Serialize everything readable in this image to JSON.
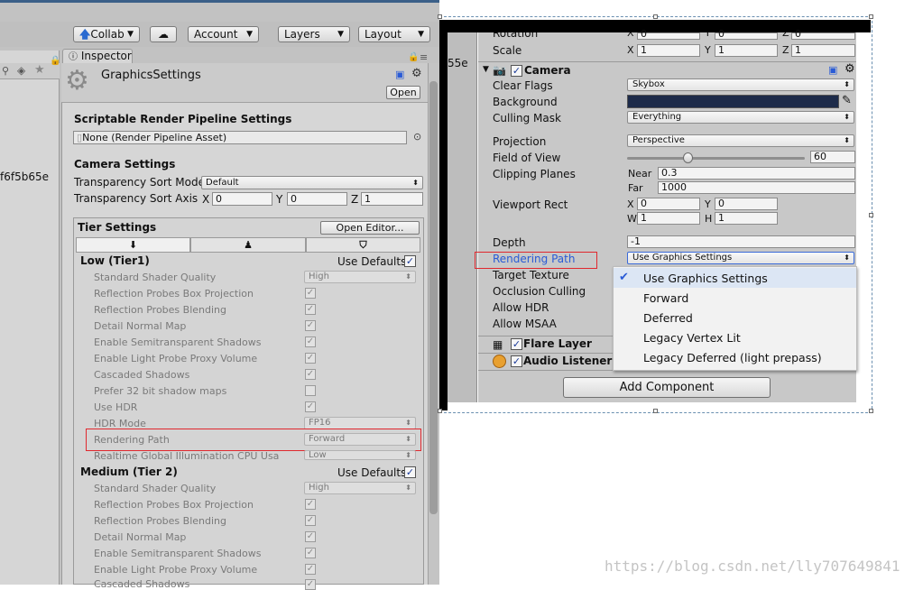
{
  "toolbar": {
    "collab": "Collab",
    "account": "Account",
    "layers": "Layers",
    "layout": "Layout"
  },
  "hierarchy": {
    "hash_fragment": "f6f5b65e",
    "hash_fragment_right": "55e"
  },
  "inspector": {
    "tab": "Inspector",
    "asset_title": "GraphicsSettings",
    "open_button": "Open",
    "srp_header": "Scriptable Render Pipeline Settings",
    "srp_field": "None (Render Pipeline Asset)",
    "camera_header": "Camera Settings",
    "sort_mode_label": "Transparency Sort Mode",
    "sort_mode_value": "Default",
    "sort_axis_label": "Transparency Sort Axis",
    "sort_axis": {
      "x_label": "X",
      "x": "0",
      "y_label": "Y",
      "y": "0",
      "z_label": "Z",
      "z": "1"
    },
    "tier_header": "Tier Settings",
    "open_editor": "Open Editor...",
    "tier1": {
      "title": "Low (Tier1)",
      "use_defaults": "Use Defaults",
      "rows": [
        {
          "label": "Standard Shader Quality",
          "value": "High"
        },
        {
          "label": "Reflection Probes Box Projection",
          "checked": true
        },
        {
          "label": "Reflection Probes Blending",
          "checked": true
        },
        {
          "label": "Detail Normal Map",
          "checked": true
        },
        {
          "label": "Enable Semitransparent Shadows",
          "checked": true
        },
        {
          "label": "Enable Light Probe Proxy Volume",
          "checked": true
        },
        {
          "label": "Cascaded Shadows",
          "checked": true
        },
        {
          "label": "Prefer 32 bit shadow maps",
          "checked": false
        },
        {
          "label": "Use HDR",
          "checked": true
        },
        {
          "label": "HDR Mode",
          "value": "FP16"
        },
        {
          "label": "Rendering Path",
          "value": "Forward"
        },
        {
          "label": "Realtime Global Illumination CPU Usa",
          "value": "Low"
        }
      ]
    },
    "tier2": {
      "title": "Medium (Tier 2)",
      "use_defaults": "Use Defaults",
      "rows": [
        {
          "label": "Standard Shader Quality",
          "value": "High"
        },
        {
          "label": "Reflection Probes Box Projection",
          "checked": true
        },
        {
          "label": "Reflection Probes Blending",
          "checked": true
        },
        {
          "label": "Detail Normal Map",
          "checked": true
        },
        {
          "label": "Enable Semitransparent Shadows",
          "checked": true
        },
        {
          "label": "Enable Light Probe Proxy Volume",
          "checked": true
        },
        {
          "label": "Cascaded Shadows",
          "checked": true
        }
      ]
    }
  },
  "camera": {
    "rotation_label": "Rotation",
    "rotation": {
      "x": "0",
      "y": "0",
      "z": "0"
    },
    "scale_label": "Scale",
    "scale": {
      "x": "1",
      "y": "1",
      "z": "1"
    },
    "component_title": "Camera",
    "clear_flags_label": "Clear Flags",
    "clear_flags": "Skybox",
    "background_label": "Background",
    "background_color": "#1d2b4a",
    "culling_mask_label": "Culling Mask",
    "culling_mask": "Everything",
    "projection_label": "Projection",
    "projection": "Perspective",
    "fov_label": "Field of View",
    "fov": "60",
    "fov_slider_fraction": 0.34,
    "clipping_label": "Clipping Planes",
    "near_label": "Near",
    "near": "0.3",
    "far_label": "Far",
    "far": "1000",
    "viewport_label": "Viewport Rect",
    "viewport": {
      "x": "0",
      "y": "0",
      "w": "1",
      "h": "1"
    },
    "depth_label": "Depth",
    "depth": "-1",
    "rendering_path_label": "Rendering Path",
    "rendering_path": "Use Graphics Settings",
    "target_texture_label": "Target Texture",
    "occlusion_label": "Occlusion Culling",
    "hdr_label": "Allow HDR",
    "msaa_label": "Allow MSAA",
    "flare_layer": "Flare Layer",
    "audio_listener": "Audio Listener",
    "add_component": "Add Component"
  },
  "popup": {
    "items": [
      "Use Graphics Settings",
      "Forward",
      "Deferred",
      "Legacy Vertex Lit",
      "Legacy Deferred (light prepass)"
    ],
    "selected_index": 0
  },
  "watermark": "https://blog.csdn.net/lly707649841",
  "colors": {
    "highlight": "#e0282e",
    "link_blue": "#2a5bd6"
  }
}
